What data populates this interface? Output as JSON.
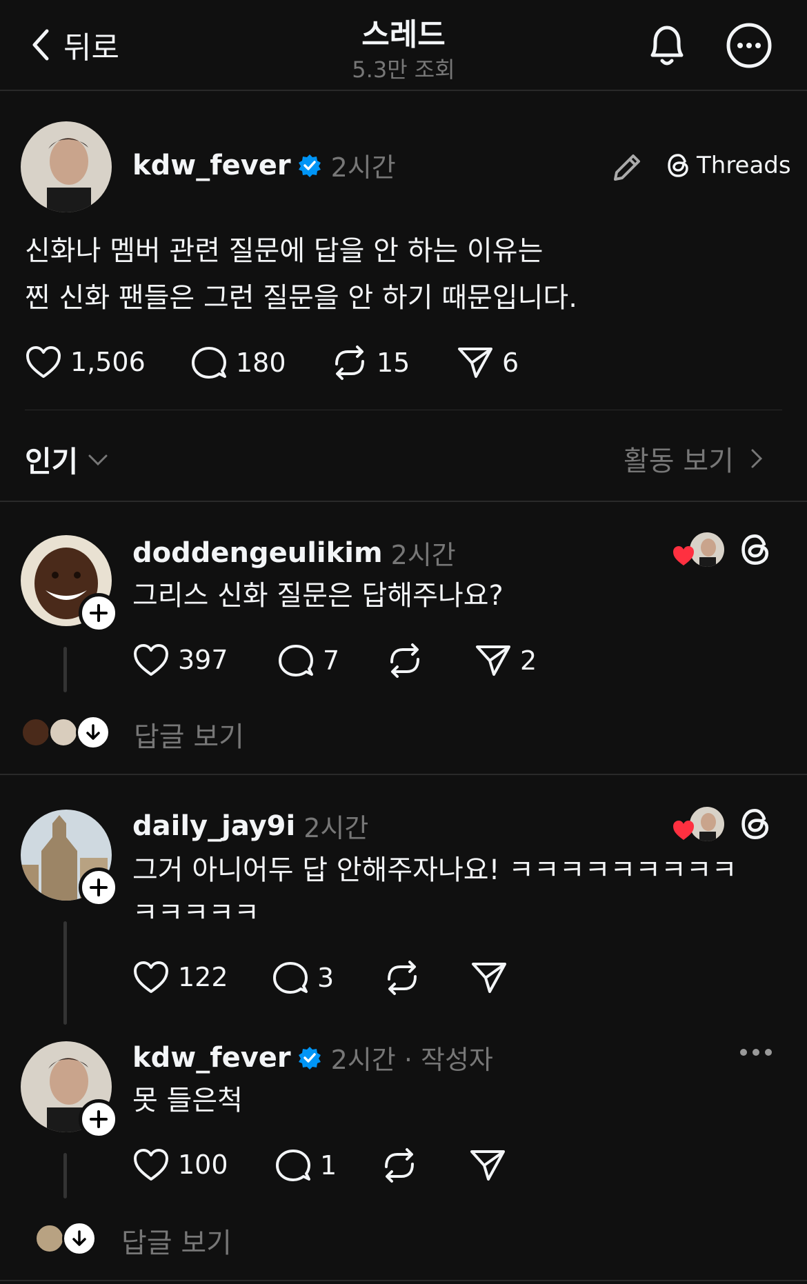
{
  "header": {
    "back_label": "뒤로",
    "title": "스레드",
    "views": "5.3만 조회"
  },
  "main_post": {
    "username": "kdw_fever",
    "time": "2시간",
    "threads_label": "Threads",
    "text_line1": "신화나 멤버 관련 질문에 답을 안 하는 이유는",
    "text_line2": "찐 신화 팬들은 그런 질문을 안 하기 때문입니다.",
    "likes": "1,506",
    "comments": "180",
    "reposts": "15",
    "shares": "6"
  },
  "sort": {
    "label": "인기",
    "activity_label": "활동 보기"
  },
  "replies": [
    {
      "username": "doddengeulikim",
      "time": "2시간",
      "text": "그리스 신화 질문은 답해주나요?",
      "likes": "397",
      "comments": "7",
      "shares": "2",
      "view_replies": "답글 보기"
    },
    {
      "username": "daily_jay9i",
      "time": "2시간",
      "text_line1": "그거 아니어두 답 안해주자나요! ㅋㅋㅋㅋㅋㅋㅋㅋㅋ",
      "text_line2": "ㅋㅋㅋㅋㅋ",
      "likes": "122",
      "comments": "3"
    },
    {
      "username": "kdw_fever",
      "time": "2시간 · 작성자",
      "text": "못 들은척",
      "likes": "100",
      "comments": "1",
      "view_replies": "답글 보기"
    }
  ],
  "colors": {
    "background": "#101010",
    "text": "#f3f5f7",
    "muted": "#777777",
    "verified": "#0095f6",
    "heart": "#ff3040"
  }
}
